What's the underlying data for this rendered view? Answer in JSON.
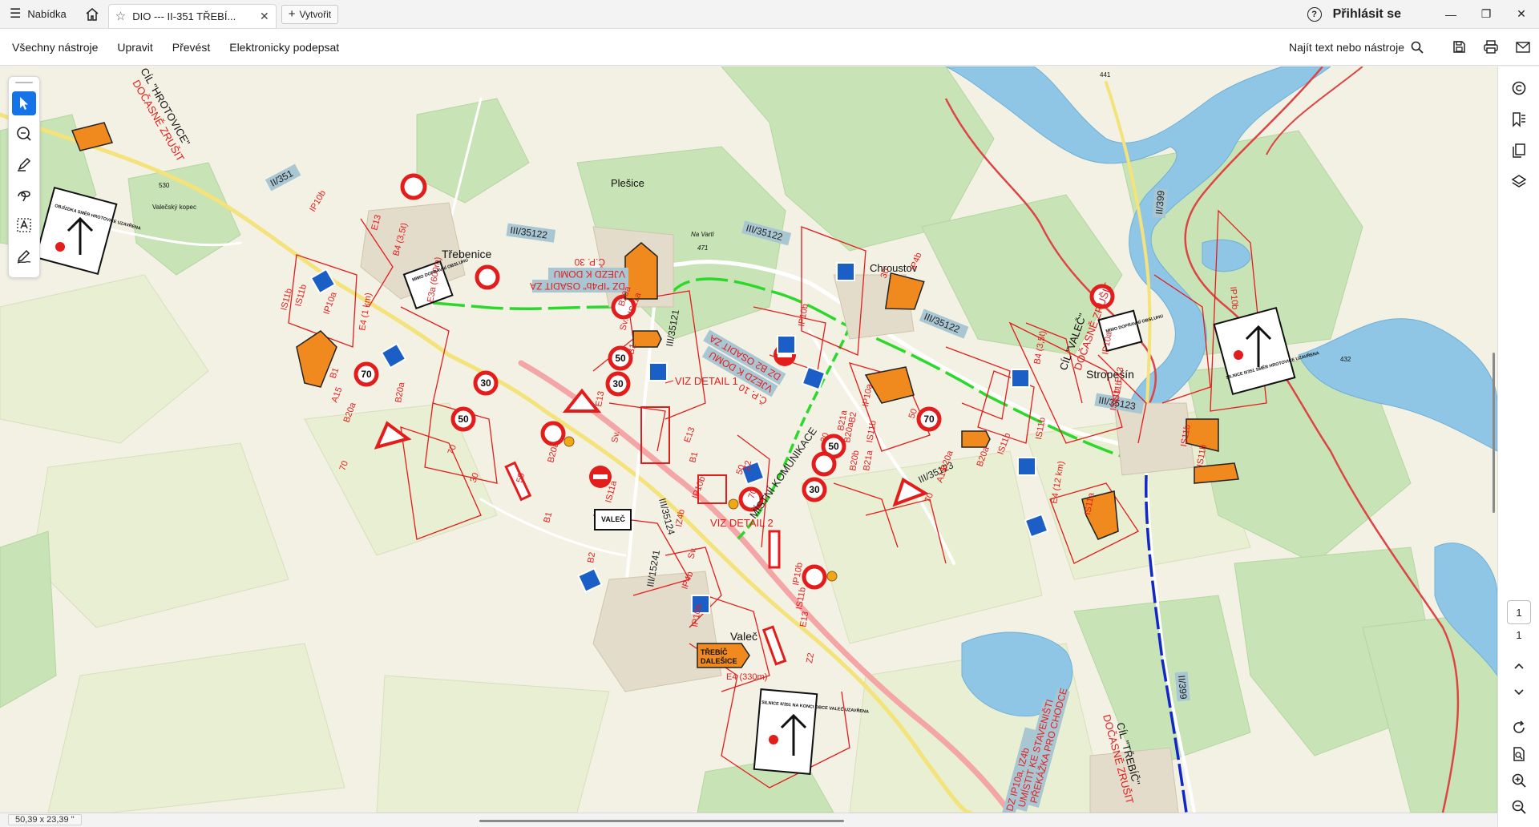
{
  "tabbar": {
    "menu_label": "Nabídka",
    "tab_title": "DIO --- II-351 TŘEBÍ...",
    "create_label": "Vytvořit",
    "signin_label": "Přihlásit se",
    "help_glyph": "?"
  },
  "menubar": {
    "items": [
      "Všechny nástroje",
      "Upravit",
      "Převést",
      "Elektronicky podepsat"
    ],
    "find_label": "Najít text nebo nástroje"
  },
  "statusbar": {
    "dimensions": "50,39 x 23,39 \""
  },
  "pagenav": {
    "current": "1",
    "total": "1"
  },
  "map": {
    "places": [
      "Třebenice",
      "Plešice",
      "Chroustov",
      "Stropešín",
      "Valeč",
      "Na Varti",
      "471",
      "Valečský kopec",
      "530",
      "441",
      "432"
    ],
    "roads": [
      "II/351",
      "III/35122",
      "III/35122",
      "III/35122",
      "III/35121",
      "III/35123",
      "III/35123",
      "III/35124",
      "III/15241",
      "II/399",
      "II/399",
      "MÍSTNÍ KOMUNIKACE"
    ],
    "details": [
      "VIZ DETAIL 1",
      "VIZ DETAIL 2"
    ],
    "annotations": [
      "CÍL \"HROTOVICE\"",
      "DOČASNĚ ZRUŠIT",
      "CÍL \"VALEČ\"",
      "DOČASNĚ ZRUŠIT",
      "CÍL \"TŘEBÍČ\"",
      "DOČASNĚ ZRUŠIT",
      "DZ \"IP4b\" OSADIT ZA",
      "VJEZD K DOMU",
      "Č.P. 30",
      "DZ B2 OSADIT ZA",
      "VJEZD K DOMU",
      "Č.P. 10",
      "DZ IP10a, IZ4b",
      "UMÍSTIT KE STAVENIŠTI",
      "PŘEKÁŽKA PRO CHODCE"
    ],
    "sign_codes": [
      "IP10b",
      "E13",
      "B4 (3,5t)",
      "IS11b",
      "IS11b",
      "IP10a",
      "E4 (1 km)",
      "E3a (600m)",
      "B1",
      "A15",
      "B20a",
      "B20a",
      "70",
      "70",
      "30",
      "50",
      "B20a",
      "B1",
      "E13",
      "Sv.",
      "IS11a",
      "B2",
      "IZ4b",
      "IP10b",
      "B1",
      "E13",
      "Z2",
      "Sv.",
      "IP4b",
      "IP10a",
      "E4 (330m)",
      "IP10b",
      "IS11b",
      "E13",
      "Z2",
      "B1",
      "Sv.",
      "IS11a",
      "B20a",
      "B21a",
      "B20b",
      "B20a",
      "B21a",
      "B20a",
      "A15",
      "B20a",
      "IS11b",
      "IP10a",
      "B2",
      "IS11b",
      "IP10b",
      "E4 (12 km)",
      "IS11b",
      "IS11a",
      "IP10b",
      "B4 (3,5t)",
      "E13",
      "IS11b",
      "IS11b",
      "IP10a",
      "IS11b",
      "IS11b",
      "IP4b",
      "30",
      "50",
      "70",
      "70",
      "50",
      "30"
    ],
    "direction_signs": [
      "TŘEBÍČ",
      "DALEŠICE",
      "VALEČ"
    ],
    "info_panels": [
      "OBJÍZDKA SMĚR HROTOVICE UZAVŘENA",
      "MIMO DOPRAVNÍ OBSLUHU",
      "MIMO DOPRAVNÍ OBSLUHU",
      "SILNICE II/351 NA KONCI OBCE VALEČ UZAVŘENA",
      "SILNICE II/351 SMĚR HROTOVICE UZAVŘENA"
    ],
    "colors": {
      "closed_route": "#f4a6a6",
      "detour_green": "#2bd82b",
      "detour_blue": "#1227c8",
      "annotation_red": "#e31c1c",
      "water": "#8fc6e6",
      "forest": "#c8e3b6",
      "background": "#f3f1e4"
    }
  }
}
